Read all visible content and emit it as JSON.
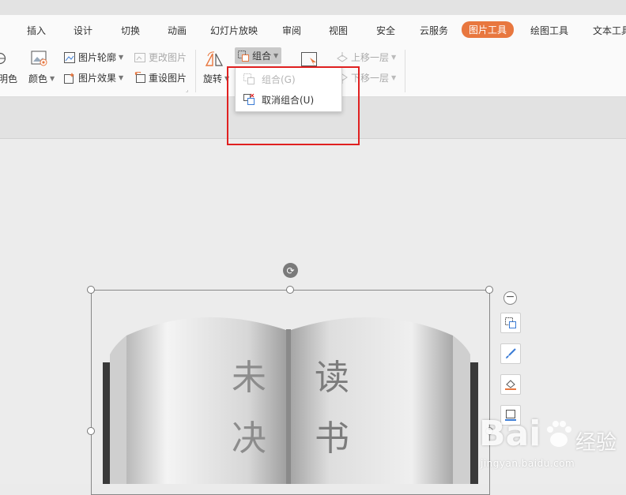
{
  "tabs": [
    {
      "label": "插入",
      "active": false
    },
    {
      "label": "设计",
      "active": false
    },
    {
      "label": "切换",
      "active": false
    },
    {
      "label": "动画",
      "active": false
    },
    {
      "label": "幻灯片放映",
      "active": false
    },
    {
      "label": "审阅",
      "active": false
    },
    {
      "label": "视图",
      "active": false
    },
    {
      "label": "安全",
      "active": false
    },
    {
      "label": "云服务",
      "active": false
    },
    {
      "label": "图片工具",
      "active": true
    },
    {
      "label": "绘图工具",
      "active": false
    },
    {
      "label": "文本工具",
      "active": false
    }
  ],
  "ribbon": {
    "transparent_color": "明色",
    "color": "颜色",
    "picture_outline": "图片轮廓",
    "picture_effects": "图片效果",
    "change_picture": "更改图片",
    "reset_picture": "重设图片",
    "rotate": "旋转",
    "group": "组合",
    "bring_forward": "上移一层",
    "send_backward": "下移一层"
  },
  "dropdown": {
    "group_item": "组合(G)",
    "ungroup_item": "取消组合(U)"
  },
  "book": {
    "left_text": [
      "未",
      "决"
    ],
    "right_text": [
      "读",
      "书"
    ]
  },
  "watermark": {
    "brand": "Bai",
    "brand_suffix": "经验",
    "url": "jingyan.baidu.com"
  },
  "colors": {
    "accent_tab": "#e8773f",
    "highlight_box": "#e02020",
    "selection_handle": "#777777"
  }
}
